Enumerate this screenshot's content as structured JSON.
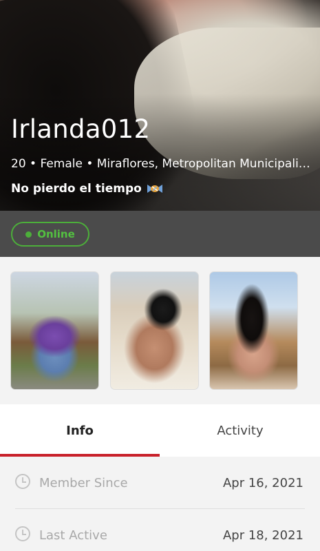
{
  "profile": {
    "username": "Irlanda012",
    "details": "20 • Female • Miraflores, Metropolitan Municipali…",
    "status_message": "No pierdo el tiempo",
    "status_emoji": "candy-icon"
  },
  "presence": {
    "label": "Online",
    "color": "#4caf3a"
  },
  "photos": {
    "count": 3
  },
  "tabs": [
    {
      "label": "Info",
      "active": true
    },
    {
      "label": "Activity",
      "active": false
    }
  ],
  "info_rows": [
    {
      "label": "Member Since",
      "value": "Apr 16, 2021",
      "icon": "clock-icon"
    },
    {
      "label": "Last Active",
      "value": "Apr 18, 2021",
      "icon": "clock-icon"
    }
  ],
  "colors": {
    "accent": "#c8202a",
    "online": "#4caf3a",
    "dark_bar": "#4b4b4b"
  }
}
